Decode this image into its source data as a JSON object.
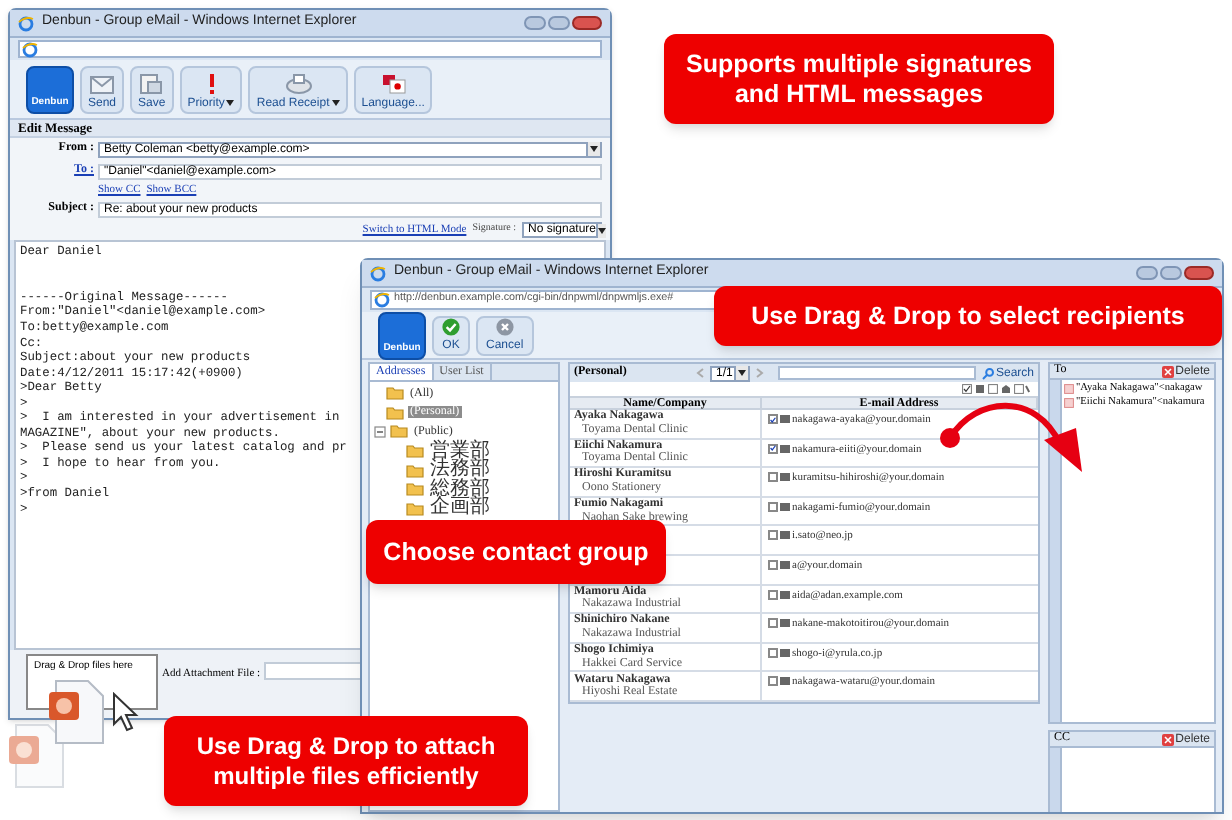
{
  "compose_window": {
    "title": "Denbun - Group eMail - Windows Internet Explorer",
    "logo_text": "Denbun",
    "toolbar": [
      {
        "label": "Send",
        "kind": "button"
      },
      {
        "label": "Save",
        "kind": "button"
      },
      {
        "label": "Priority",
        "kind": "dropdown"
      },
      {
        "label": "Read Receipt",
        "kind": "dropdown"
      },
      {
        "label": "Language...",
        "kind": "button"
      }
    ],
    "section_title": "Edit Message",
    "from": {
      "label": "From :",
      "value": "Betty Coleman <betty@example.com>"
    },
    "to": {
      "label": "To :",
      "value": "\"Daniel\"<daniel@example.com>"
    },
    "cc_links": [
      "Show CC",
      "Show BCC"
    ],
    "subject": {
      "label": "Subject :",
      "value": "Re: about your new products"
    },
    "html_mode_link": "Switch to HTML Mode",
    "signature": {
      "label": "Signature :",
      "value": "No signature"
    },
    "body": "Dear Daniel\n\n\n------Original Message------\nFrom:\"Daniel\"<daniel@example.com>\nTo:betty@example.com\nCc:\nSubject:about your new products\nDate:4/12/2011 15:17:42(+0900)\n>Dear Betty\n>\n>  I am interested in your advertisement in\nMAGAZINE\", about your new products.\n>  Please send us your latest catalog and pr\n>  I hope to hear from you.\n>\n>from Daniel\n>",
    "drop_zone": "Drag & Drop files here",
    "attachment_label": "Add Attachment File :"
  },
  "address_window": {
    "title": "Denbun - Group eMail - Windows Internet Explorer",
    "url": "http://denbun.example.com/cgi-bin/dnpwml/dnpwmljs.exe#",
    "logo_text": "Denbun",
    "toolbar": [
      {
        "label": "OK",
        "kind": "ok"
      },
      {
        "label": "Cancel",
        "kind": "cancel"
      }
    ],
    "tabs": [
      {
        "label": "Addresses",
        "selected": true
      },
      {
        "label": "User List",
        "selected": false
      }
    ],
    "tree": [
      {
        "label": "(All)",
        "selected": false
      },
      {
        "label": "(Personal)",
        "selected": true
      },
      {
        "label": "(Public)",
        "selected": false,
        "expanded": true,
        "children": [
          {
            "label": "営業部",
            "selected": false
          },
          {
            "label": "法務部",
            "selected": false
          },
          {
            "label": "総務部",
            "selected": false
          },
          {
            "label": "企画部",
            "selected": false
          }
        ]
      }
    ],
    "list_title": "(Personal)",
    "page": "1/1",
    "search_button": "Search",
    "columns": [
      "Name/Company",
      "E-mail Address"
    ],
    "contacts": [
      {
        "name": "Ayaka Nakagawa",
        "company": "Toyama Dental Clinic",
        "email": "nakagawa-ayaka@your.domain",
        "checked": true
      },
      {
        "name": "Eiichi Nakamura",
        "company": "Toyama Dental Clinic",
        "email": "nakamura-eiiti@your.domain",
        "checked": true
      },
      {
        "name": "Hiroshi Kuramitsu",
        "company": "Oono Stationery",
        "email": "kuramitsu-hihiroshi@your.domain",
        "checked": false
      },
      {
        "name": "Fumio Nakagami",
        "company": "Naohan Sake brewing",
        "email": "nakagami-fumio@your.domain",
        "checked": false
      },
      {
        "email": "i.sato@neo.jp",
        "checked": false
      },
      {
        "email": "a@your.domain",
        "checked": false
      },
      {
        "name": "Mamoru Aida",
        "company": "Nakazawa Industrial",
        "email": "aida@adan.example.com",
        "checked": false
      },
      {
        "name": "Shinichiro Nakane",
        "company": "Nakazawa Industrial",
        "email": "nakane-makotoitirou@your.domain",
        "checked": false
      },
      {
        "name": "Shogo Ichimiya",
        "company": "Hakkei Card Service",
        "email": "shogo-i@yrula.co.jp",
        "checked": false
      },
      {
        "name": "Wataru Nakagawa",
        "company": "Hiyoshi Real Estate",
        "email": "nakagawa-wataru@your.domain",
        "checked": false
      }
    ],
    "to_label": "To",
    "to_delete": "Delete",
    "recipients": [
      "\"Ayaka Nakagawa\"<nakagaw",
      "\"Eiichi Nakamura\"<nakamura"
    ],
    "cc_label": "CC",
    "cc_delete": "Delete"
  },
  "callouts": [
    {
      "text": "Supports multiple signatures and HTML messages",
      "kind": "signatures"
    },
    {
      "text": "Use Drag & Drop to select recipients",
      "kind": "recipients"
    },
    {
      "text": "Choose contact group",
      "kind": "group"
    },
    {
      "text": "Use Drag & Drop to attach multiple files efficiently",
      "kind": "attach"
    }
  ]
}
